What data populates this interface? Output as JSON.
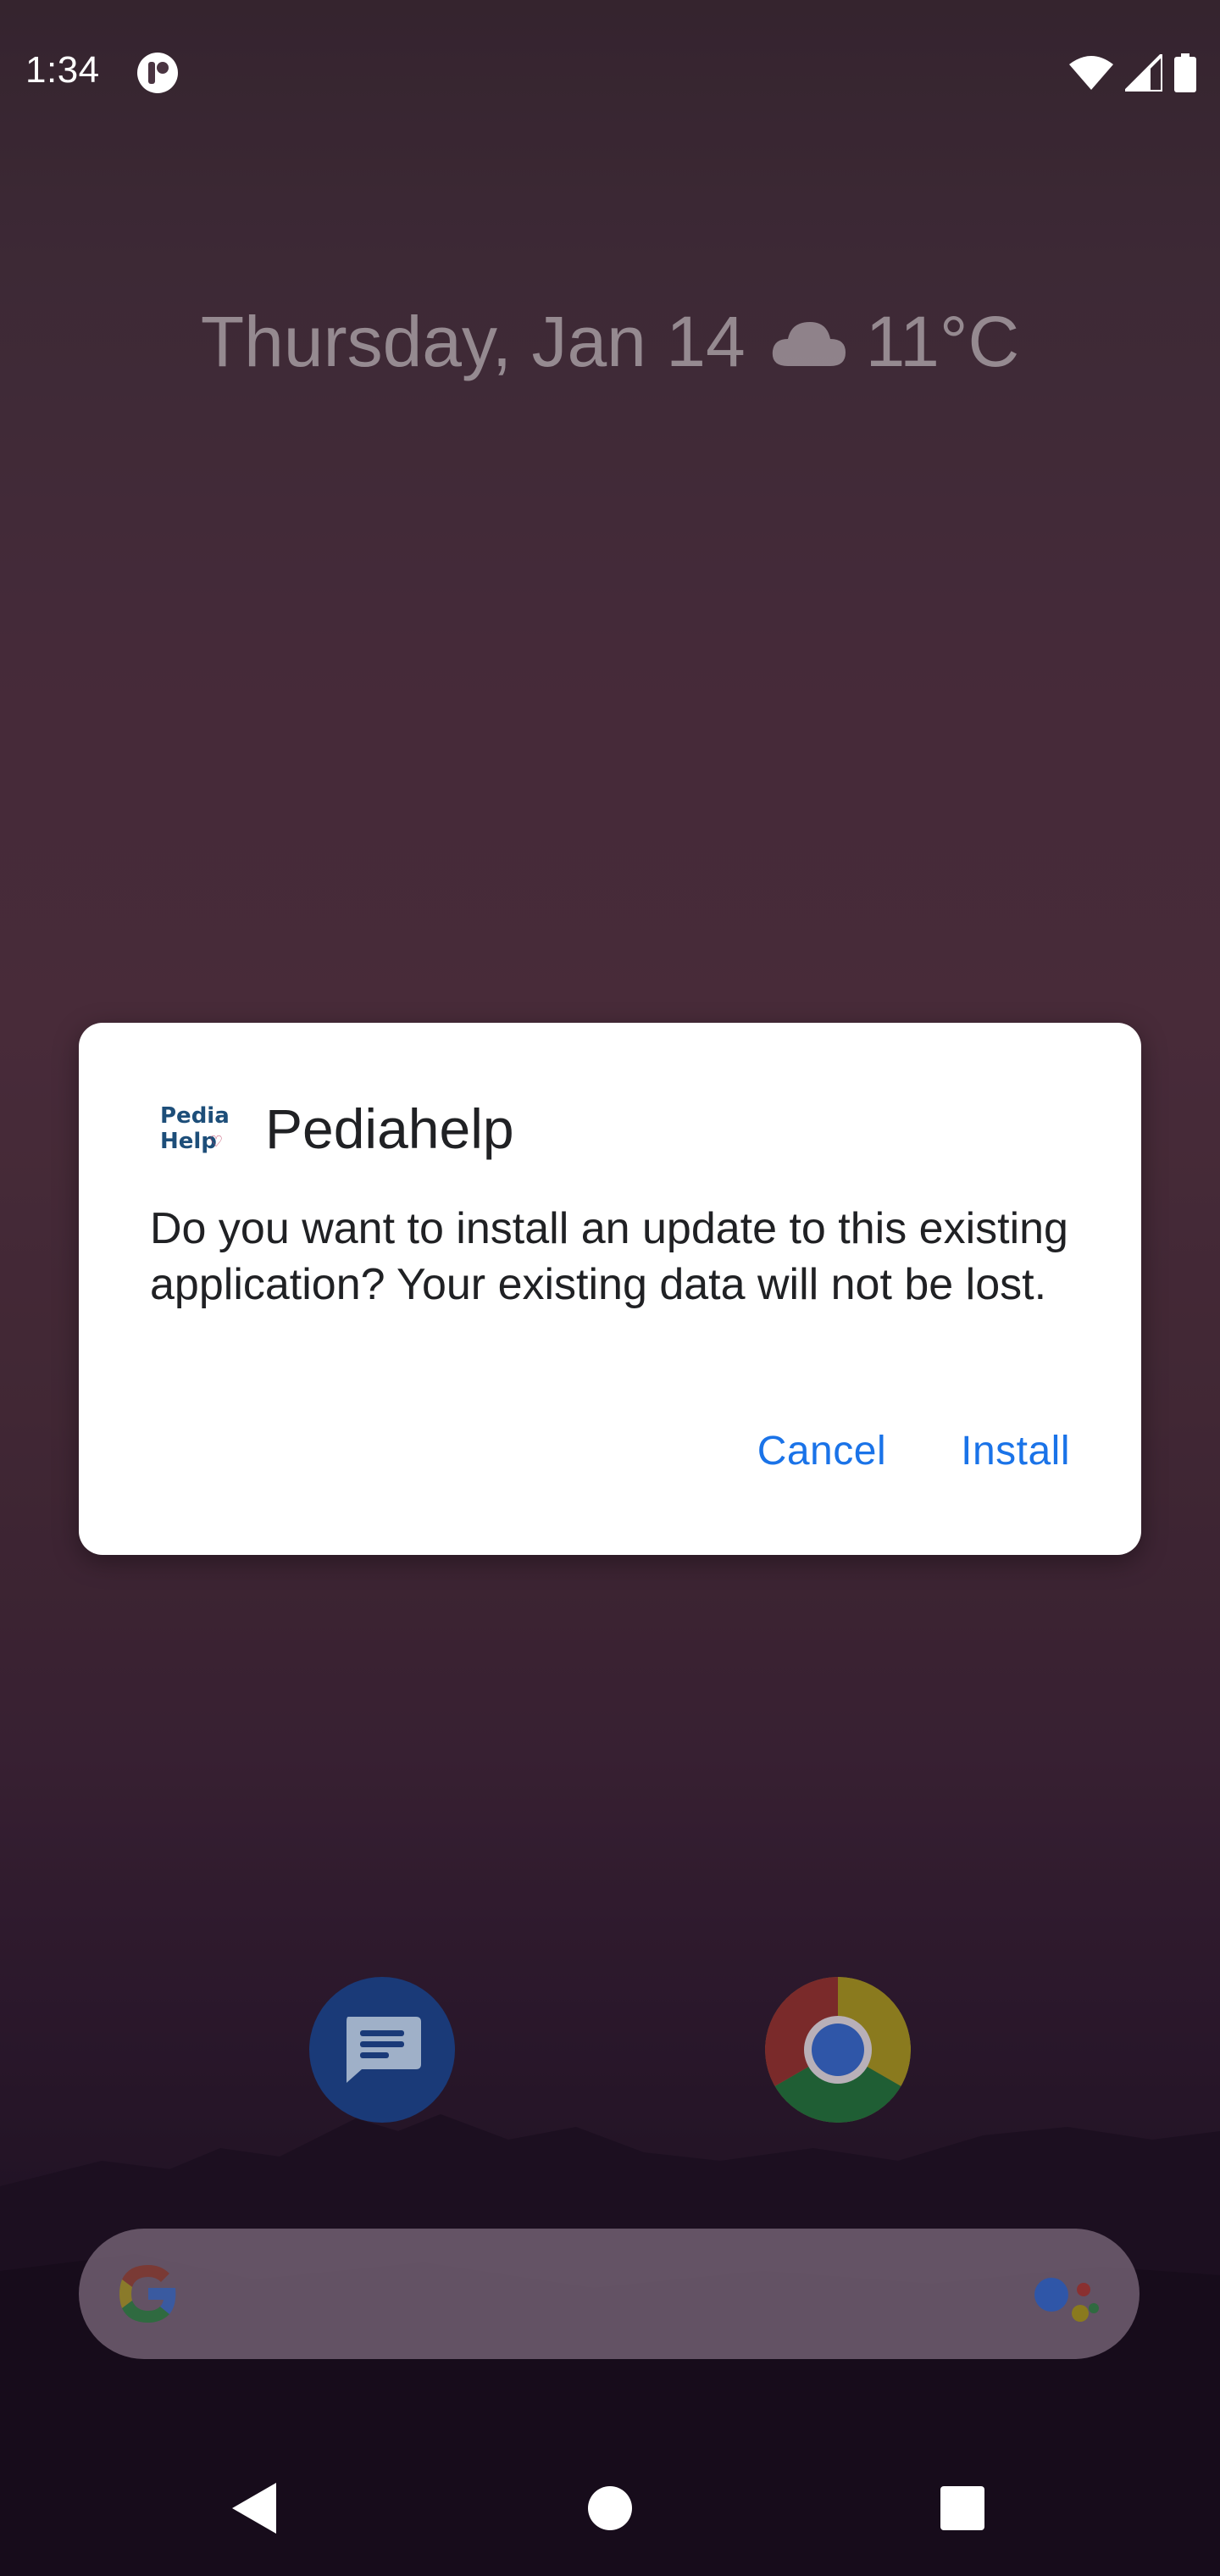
{
  "status_bar": {
    "time": "1:34",
    "icons": [
      "app-notification-icon",
      "wifi-icon",
      "signal-icon",
      "battery-icon"
    ]
  },
  "home": {
    "date": "Thursday, Jan 14",
    "weather_icon": "cloud-icon",
    "temperature": "11°C"
  },
  "dock": [
    {
      "name": "Messages",
      "icon": "messages-icon"
    },
    {
      "name": "Chrome",
      "icon": "chrome-icon"
    }
  ],
  "search": {
    "left_icon": "google-g-icon",
    "right_icon": "assistant-icon"
  },
  "nav": {
    "buttons": [
      "back",
      "home",
      "recents"
    ]
  },
  "dialog": {
    "app_name": "Pediahelp",
    "logo_text_line1": "Pedia",
    "logo_text_line2": "Help",
    "message": "Do you want to install an update to this existing application? Your existing data will not be lost.",
    "cancel_label": "Cancel",
    "install_label": "Install",
    "accent_color": "#1a73e8"
  }
}
